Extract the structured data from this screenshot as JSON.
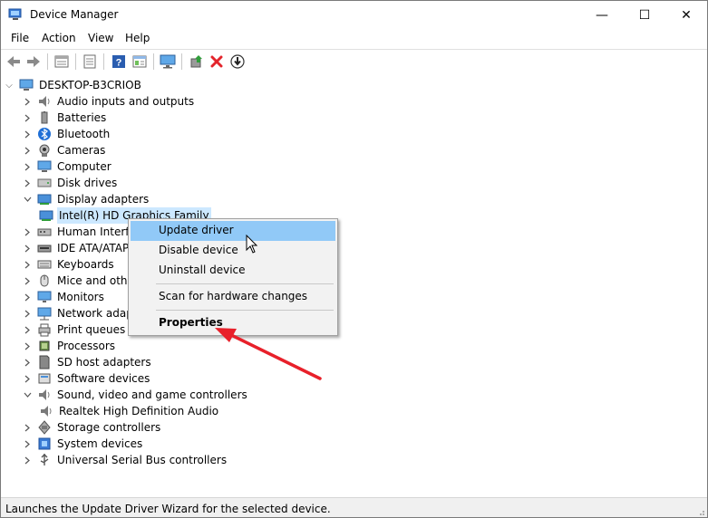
{
  "window": {
    "title": "Device Manager",
    "minimize_glyph": "—",
    "maximize_glyph": "☐",
    "close_glyph": "✕"
  },
  "menu": {
    "items": [
      "File",
      "Action",
      "View",
      "Help"
    ]
  },
  "toolbar": {
    "icons": [
      "back-arrow-icon",
      "forward-arrow-icon",
      "properties-view-icon",
      "show-hidden-icon",
      "help-icon",
      "action-pane-icon",
      "monitor-icon",
      "update-driver-icon",
      "uninstall-icon",
      "download-icon"
    ]
  },
  "tree": {
    "root": "DESKTOP-B3CRIOB",
    "items": [
      {
        "label": "Audio inputs and outputs",
        "icon": "speaker-icon",
        "expanded": false
      },
      {
        "label": "Batteries",
        "icon": "battery-icon",
        "expanded": false
      },
      {
        "label": "Bluetooth",
        "icon": "bluetooth-icon",
        "expanded": false
      },
      {
        "label": "Cameras",
        "icon": "camera-icon",
        "expanded": false
      },
      {
        "label": "Computer",
        "icon": "computer-icon",
        "expanded": false
      },
      {
        "label": "Disk drives",
        "icon": "disk-drive-icon",
        "expanded": false
      },
      {
        "label": "Display adapters",
        "icon": "display-adapter-icon",
        "expanded": true
      },
      {
        "label": "Intel(R) HD Graphics Family",
        "icon": "display-adapter-icon",
        "child": true,
        "selected": true
      },
      {
        "label": "Human Interfa",
        "icon": "hid-icon",
        "expanded": false
      },
      {
        "label": "IDE ATA/ATAP",
        "icon": "ide-icon",
        "expanded": false
      },
      {
        "label": "Keyboards",
        "icon": "keyboard-icon",
        "expanded": false
      },
      {
        "label": "Mice and othe",
        "icon": "mouse-icon",
        "expanded": false
      },
      {
        "label": "Monitors",
        "icon": "monitor-icon",
        "expanded": false
      },
      {
        "label": "Network adap",
        "icon": "network-icon",
        "expanded": false
      },
      {
        "label": "Print queues",
        "icon": "printer-icon",
        "expanded": false
      },
      {
        "label": "Processors",
        "icon": "processor-icon",
        "expanded": false
      },
      {
        "label": "SD host adapters",
        "icon": "sd-card-icon",
        "expanded": false
      },
      {
        "label": "Software devices",
        "icon": "software-device-icon",
        "expanded": false
      },
      {
        "label": "Sound, video and game controllers",
        "icon": "speaker-icon",
        "expanded": true
      },
      {
        "label": "Realtek High Definition Audio",
        "icon": "speaker-icon",
        "child": true
      },
      {
        "label": "Storage controllers",
        "icon": "storage-icon",
        "expanded": false
      },
      {
        "label": "System devices",
        "icon": "system-device-icon",
        "expanded": false
      },
      {
        "label": "Universal Serial Bus controllers",
        "icon": "usb-icon",
        "expanded": false
      }
    ]
  },
  "context_menu": {
    "items": [
      {
        "label": "Update driver",
        "highlighted": true
      },
      {
        "label": "Disable device"
      },
      {
        "label": "Uninstall device"
      },
      {
        "label": "Scan for hardware changes"
      },
      {
        "label": "Properties",
        "bold": true
      }
    ]
  },
  "status": {
    "text": "Launches the Update Driver Wizard for the selected device."
  },
  "colors": {
    "annotation_arrow": "#e8202a",
    "selection": "#cce8ff",
    "menu_highlight": "#91c9f7"
  }
}
